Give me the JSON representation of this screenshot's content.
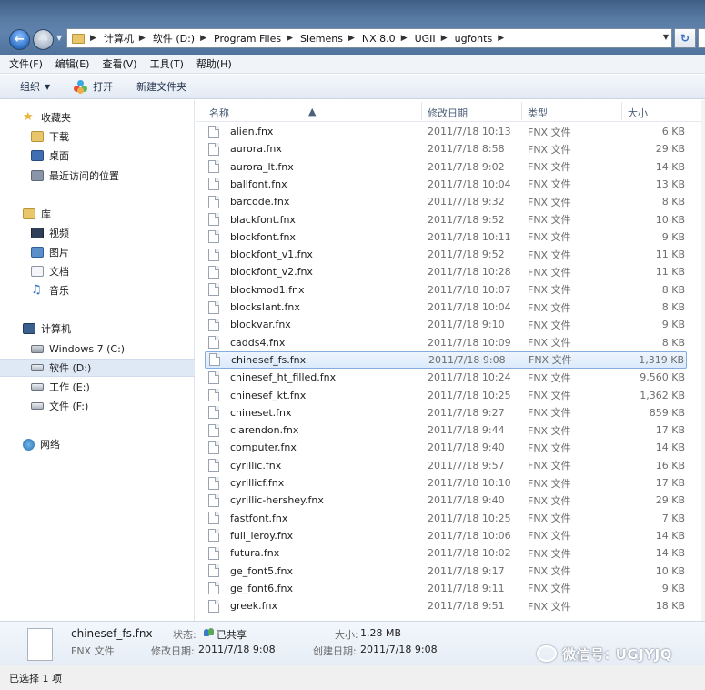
{
  "address": {
    "crumbs": [
      "计算机",
      "软件 (D:)",
      "Program Files",
      "Siemens",
      "NX 8.0",
      "UGII",
      "ugfonts"
    ]
  },
  "menu": [
    "文件(F)",
    "编辑(E)",
    "查看(V)",
    "工具(T)",
    "帮助(H)"
  ],
  "commands": {
    "organize": "组织",
    "open": "打开",
    "new_folder": "新建文件夹"
  },
  "nav": {
    "favorites": "收藏夹",
    "downloads": "下载",
    "desktop": "桌面",
    "recent": "最近访问的位置",
    "libraries": "库",
    "videos": "视频",
    "pictures": "图片",
    "documents": "文档",
    "music": "音乐",
    "computer": "计算机",
    "drive_c": "Windows 7 (C:)",
    "drive_d": "软件 (D:)",
    "drive_e": "工作 (E:)",
    "drive_f": "文件 (F:)",
    "network": "网络"
  },
  "columns": {
    "name": "名称",
    "date": "修改日期",
    "type": "类型",
    "size": "大小"
  },
  "files": [
    {
      "name": "alien.fnx",
      "date": "2011/7/18 10:13",
      "type": "FNX 文件",
      "size": "6 KB"
    },
    {
      "name": "aurora.fnx",
      "date": "2011/7/18 8:58",
      "type": "FNX 文件",
      "size": "29 KB"
    },
    {
      "name": "aurora_lt.fnx",
      "date": "2011/7/18 9:02",
      "type": "FNX 文件",
      "size": "14 KB"
    },
    {
      "name": "ballfont.fnx",
      "date": "2011/7/18 10:04",
      "type": "FNX 文件",
      "size": "13 KB"
    },
    {
      "name": "barcode.fnx",
      "date": "2011/7/18 9:32",
      "type": "FNX 文件",
      "size": "8 KB"
    },
    {
      "name": "blackfont.fnx",
      "date": "2011/7/18 9:52",
      "type": "FNX 文件",
      "size": "10 KB"
    },
    {
      "name": "blockfont.fnx",
      "date": "2011/7/18 10:11",
      "type": "FNX 文件",
      "size": "9 KB"
    },
    {
      "name": "blockfont_v1.fnx",
      "date": "2011/7/18 9:52",
      "type": "FNX 文件",
      "size": "11 KB"
    },
    {
      "name": "blockfont_v2.fnx",
      "date": "2011/7/18 10:28",
      "type": "FNX 文件",
      "size": "11 KB"
    },
    {
      "name": "blockmod1.fnx",
      "date": "2011/7/18 10:07",
      "type": "FNX 文件",
      "size": "8 KB"
    },
    {
      "name": "blockslant.fnx",
      "date": "2011/7/18 10:04",
      "type": "FNX 文件",
      "size": "8 KB"
    },
    {
      "name": "blockvar.fnx",
      "date": "2011/7/18 9:10",
      "type": "FNX 文件",
      "size": "9 KB"
    },
    {
      "name": "cadds4.fnx",
      "date": "2011/7/18 10:09",
      "type": "FNX 文件",
      "size": "8 KB"
    },
    {
      "name": "chinesef_fs.fnx",
      "date": "2011/7/18 9:08",
      "type": "FNX 文件",
      "size": "1,319 KB"
    },
    {
      "name": "chinesef_ht_filled.fnx",
      "date": "2011/7/18 10:24",
      "type": "FNX 文件",
      "size": "9,560 KB"
    },
    {
      "name": "chinesef_kt.fnx",
      "date": "2011/7/18 10:25",
      "type": "FNX 文件",
      "size": "1,362 KB"
    },
    {
      "name": "chineset.fnx",
      "date": "2011/7/18 9:27",
      "type": "FNX 文件",
      "size": "859 KB"
    },
    {
      "name": "clarendon.fnx",
      "date": "2011/7/18 9:44",
      "type": "FNX 文件",
      "size": "17 KB"
    },
    {
      "name": "computer.fnx",
      "date": "2011/7/18 9:40",
      "type": "FNX 文件",
      "size": "14 KB"
    },
    {
      "name": "cyrillic.fnx",
      "date": "2011/7/18 9:57",
      "type": "FNX 文件",
      "size": "16 KB"
    },
    {
      "name": "cyrillicf.fnx",
      "date": "2011/7/18 10:10",
      "type": "FNX 文件",
      "size": "17 KB"
    },
    {
      "name": "cyrillic-hershey.fnx",
      "date": "2011/7/18 9:40",
      "type": "FNX 文件",
      "size": "29 KB"
    },
    {
      "name": "fastfont.fnx",
      "date": "2011/7/18 10:25",
      "type": "FNX 文件",
      "size": "7 KB"
    },
    {
      "name": "full_leroy.fnx",
      "date": "2011/7/18 10:06",
      "type": "FNX 文件",
      "size": "14 KB"
    },
    {
      "name": "futura.fnx",
      "date": "2011/7/18 10:02",
      "type": "FNX 文件",
      "size": "14 KB"
    },
    {
      "name": "ge_font5.fnx",
      "date": "2011/7/18 9:17",
      "type": "FNX 文件",
      "size": "10 KB"
    },
    {
      "name": "ge_font6.fnx",
      "date": "2011/7/18 9:11",
      "type": "FNX 文件",
      "size": "9 KB"
    },
    {
      "name": "greek.fnx",
      "date": "2011/7/18 9:51",
      "type": "FNX 文件",
      "size": "18 KB"
    }
  ],
  "details": {
    "name": "chinesef_fs.fnx",
    "type": "FNX 文件",
    "state_label": "状态:",
    "state_value": "已共享",
    "modified_label": "修改日期:",
    "modified_value": "2011/7/18 9:08",
    "size_label": "大小:",
    "size_value": "1.28 MB",
    "created_label": "创建日期:",
    "created_value": "2011/7/18 9:08"
  },
  "watermark": "微信号: UGJYJQ",
  "status": "已选择 1 项"
}
